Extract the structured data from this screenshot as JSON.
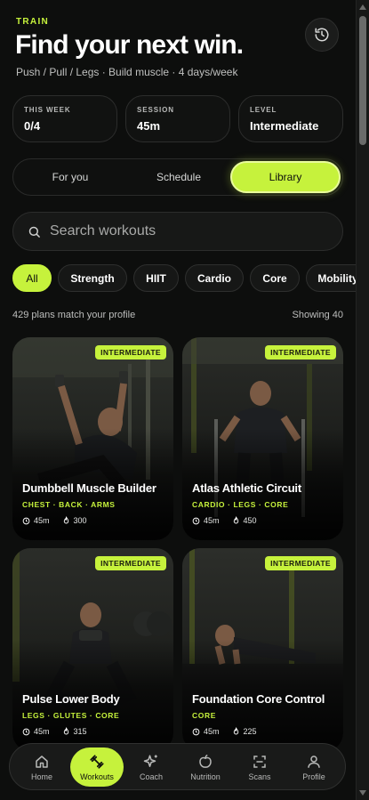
{
  "header": {
    "eyebrow": "TRAIN",
    "title": "Find your next win.",
    "subtitle": "Push / Pull / Legs · Build muscle · 4 days/week",
    "history_icon": "history-icon"
  },
  "stats": [
    {
      "label": "THIS WEEK",
      "value": "0/4"
    },
    {
      "label": "SESSION",
      "value": "45m"
    },
    {
      "label": "LEVEL",
      "value": "Intermediate"
    }
  ],
  "tabs": [
    {
      "label": "For you",
      "active": false
    },
    {
      "label": "Schedule",
      "active": false
    },
    {
      "label": "Library",
      "active": true
    }
  ],
  "search": {
    "placeholder": "Search workouts",
    "value": ""
  },
  "filters": [
    {
      "label": "All",
      "active": true
    },
    {
      "label": "Strength",
      "active": false
    },
    {
      "label": "HIIT",
      "active": false
    },
    {
      "label": "Cardio",
      "active": false
    },
    {
      "label": "Core",
      "active": false
    },
    {
      "label": "Mobility",
      "active": false
    }
  ],
  "results": {
    "match_text": "429 plans match your profile",
    "showing_text": "Showing 40"
  },
  "workouts": [
    {
      "badge": "INTERMEDIATE",
      "title": "Dumbbell Muscle Builder",
      "tags": "CHEST · BACK · ARMS",
      "duration": "45m",
      "calories": "300"
    },
    {
      "badge": "INTERMEDIATE",
      "title": "Atlas Athletic Circuit",
      "tags": "CARDIO · LEGS · CORE",
      "duration": "45m",
      "calories": "450"
    },
    {
      "badge": "INTERMEDIATE",
      "title": "Pulse Lower Body",
      "tags": "LEGS · GLUTES · CORE",
      "duration": "45m",
      "calories": "315"
    },
    {
      "badge": "INTERMEDIATE",
      "title": "Foundation Core Control",
      "tags": "CORE",
      "duration": "45m",
      "calories": "225"
    }
  ],
  "nav": [
    {
      "label": "Home",
      "icon": "home-icon",
      "active": false
    },
    {
      "label": "Workouts",
      "icon": "dumbbell-icon",
      "active": true
    },
    {
      "label": "Coach",
      "icon": "sparkle-icon",
      "active": false
    },
    {
      "label": "Nutrition",
      "icon": "apple-icon",
      "active": false
    },
    {
      "label": "Scans",
      "icon": "scan-icon",
      "active": false
    },
    {
      "label": "Profile",
      "icon": "user-icon",
      "active": false
    }
  ],
  "colors": {
    "accent": "#c6f23c",
    "background": "#0d0e0d",
    "card": "#111211"
  }
}
